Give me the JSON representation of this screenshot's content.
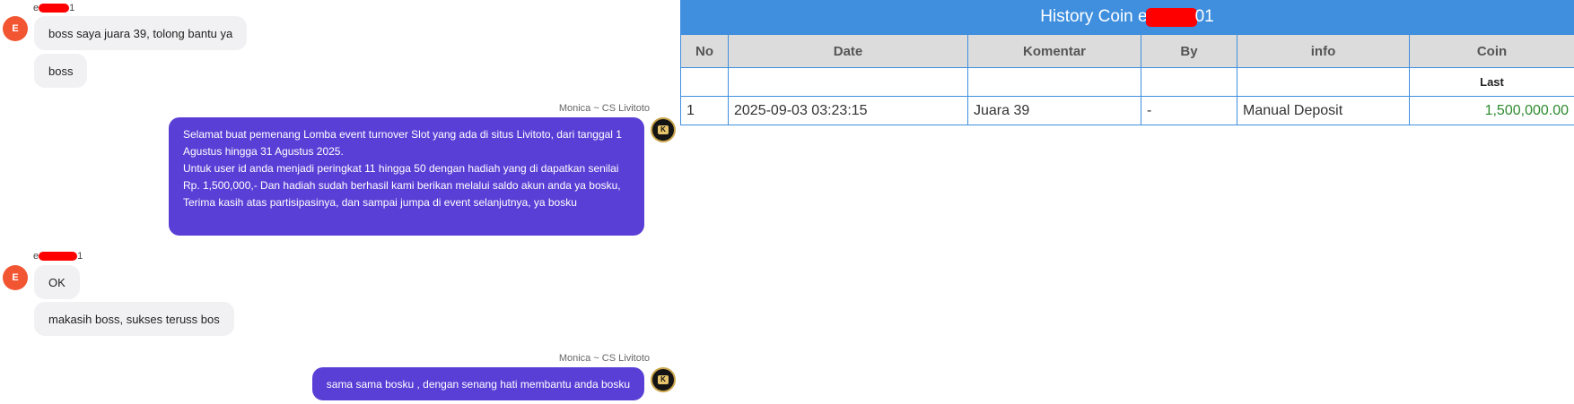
{
  "chat": {
    "user_avatar_letter": "E",
    "user_name_start": "e",
    "user_name_end": "1",
    "agent_name": "Monica ~ CS Livitoto",
    "agent_logo_letter": "K",
    "messages": {
      "m1": "boss saya juara 39, tolong bantu ya",
      "m2": "boss",
      "m3_p1": "Selamat buat pemenang Lomba event turnover Slot yang ada di situs Livitoto, dari tanggal 1 Agustus hingga 31 Agustus 2025.",
      "m3_p2": "Untuk user id anda menjadi peringkat 11 hingga 50 dengan hadiah yang di dapatkan senilai Rp. 1,500,000,- Dan hadiah sudah berhasil kami berikan melalui saldo akun anda ya bosku, Terima kasih atas partisipasinya, dan sampai jumpa di event selanjutnya, ya bosku",
      "m4": "OK",
      "m5": "makasih boss, sukses teruss bos",
      "m6": "sama sama bosku , dengan senang hati membantu anda bosku"
    }
  },
  "history": {
    "title_prefix": "History Coin e",
    "title_suffix": "01",
    "columns": {
      "no": "No",
      "date": "Date",
      "komentar": "Komentar",
      "by": "By",
      "info": "info",
      "coin": "Coin"
    },
    "last_label": "Last",
    "row": {
      "no": "1",
      "date": "2025-09-03 03:23:15",
      "komentar": "Juara 39",
      "by": "-",
      "info": "Manual Deposit",
      "coin": "1,500,000.00"
    }
  },
  "colors": {
    "user_avatar": "#f25532",
    "agent_bubble": "#5a3fd6",
    "table_header_bar": "#3f8fde",
    "coin_value": "#2e8b2e",
    "redaction": "#ff0000"
  }
}
